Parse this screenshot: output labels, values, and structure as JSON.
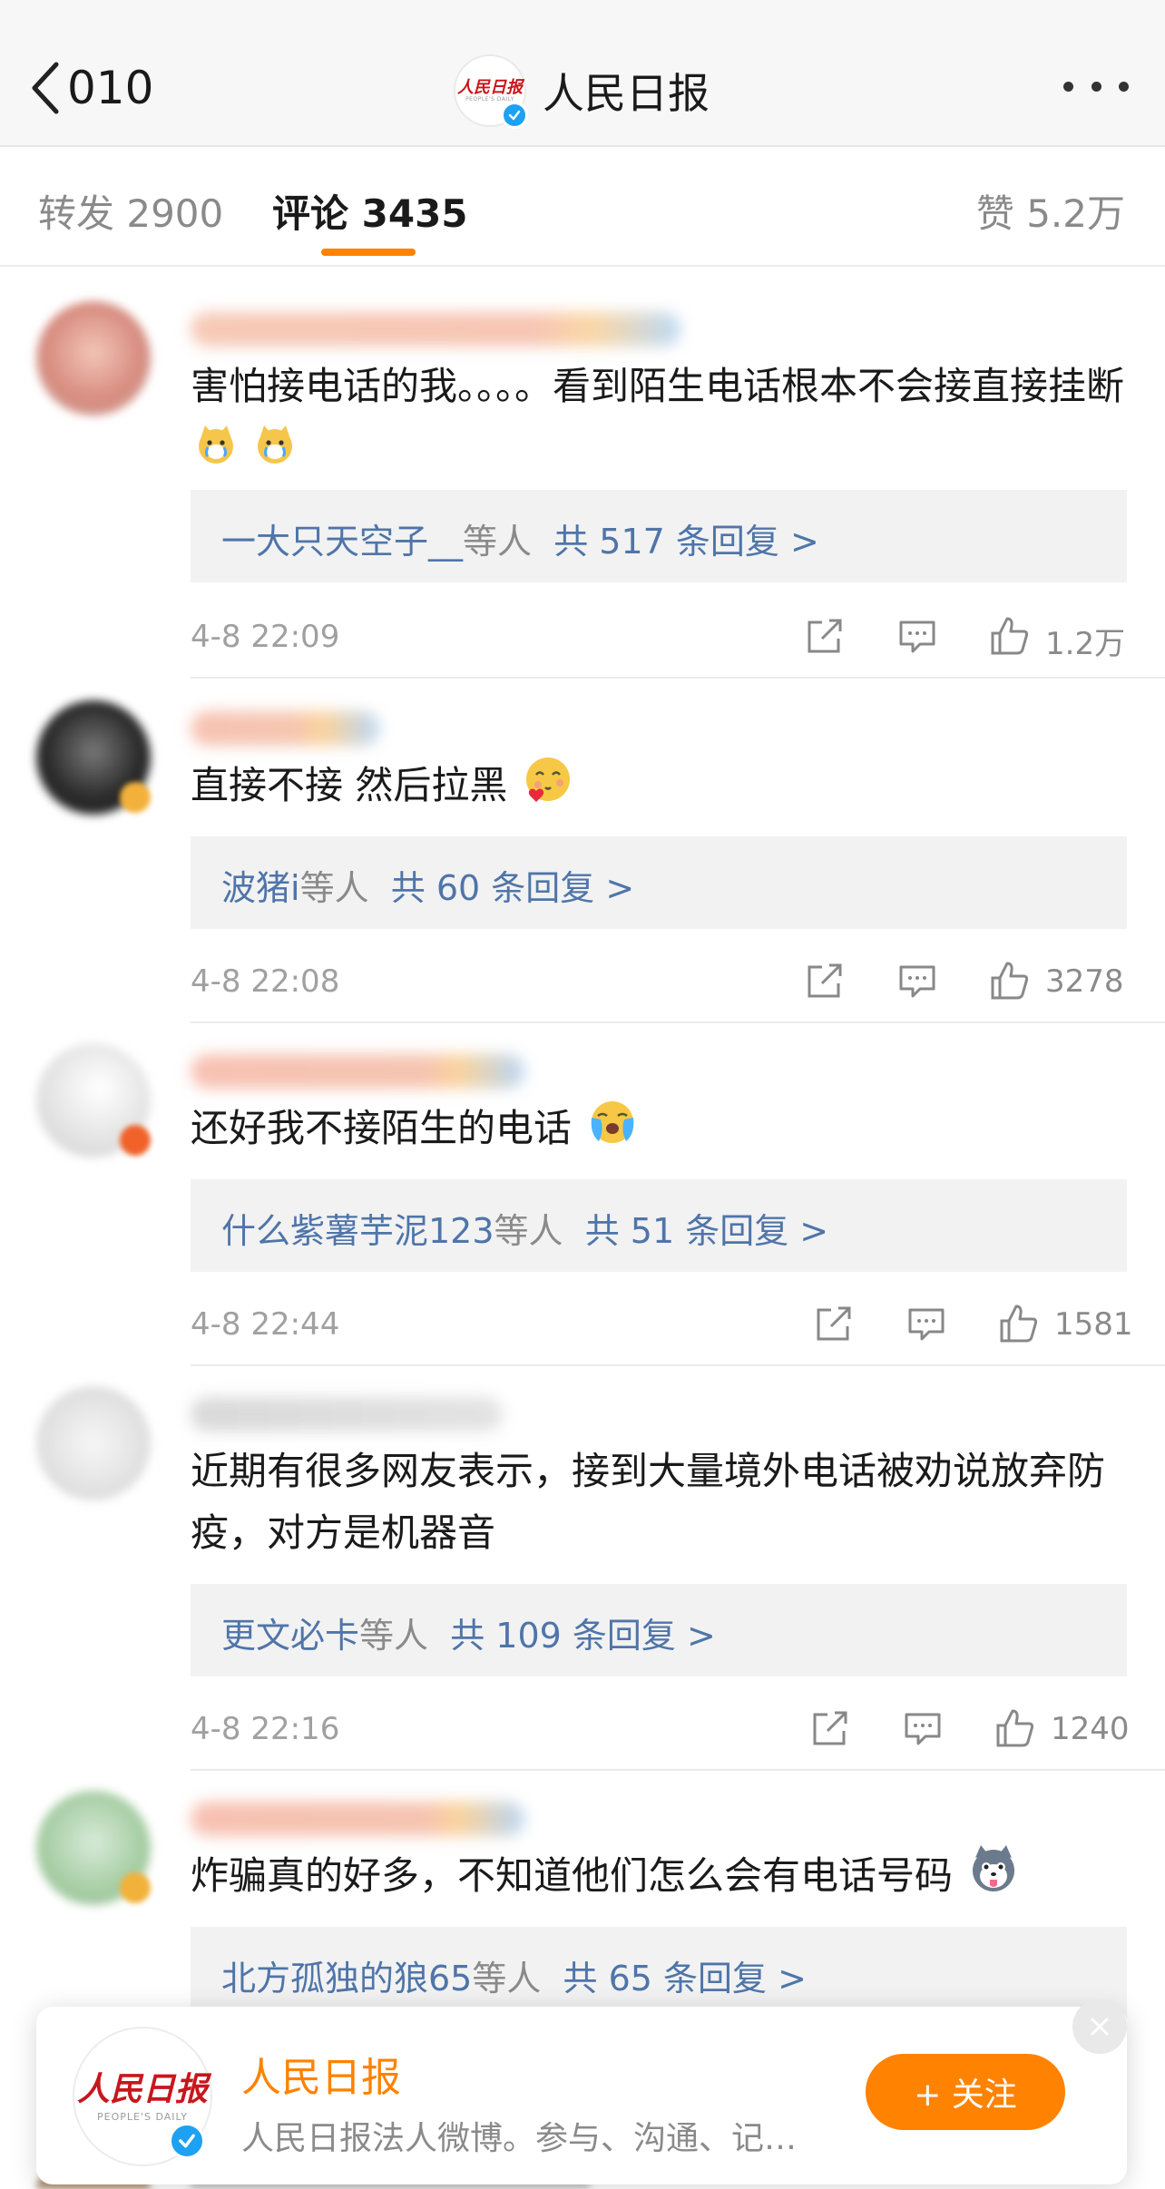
{
  "nav": {
    "back_count": "010",
    "title": "人民日报",
    "avatar_logo": "人民日报",
    "avatar_logo_en": "PEOPLE'S DAILY"
  },
  "tabs": {
    "repost": "转发 2900",
    "comments": "评论 3435",
    "likes": "赞 5.2万"
  },
  "comments": [
    {
      "text": "害怕接电话的我。。。。看到陌生电话根本不会接直接挂断",
      "emoji": [
        "crying-cat-emoji",
        "crying-cat-emoji"
      ],
      "reply_users": "一大只天空子__",
      "reply_sep": "等人",
      "reply_total": "共 517 条回复 >",
      "time": "4-8 22:09",
      "likes": "1.2万"
    },
    {
      "text": "直接不接 然后拉黑",
      "emoji": [
        "loving-face-emoji"
      ],
      "reply_users": "波猪i",
      "reply_sep": "等人",
      "reply_total": "共 60 条回复 >",
      "time": "4-8 22:08",
      "likes": "3278"
    },
    {
      "text": "还好我不接陌生的电话",
      "emoji": [
        "crying-face-emoji"
      ],
      "reply_users": "什么紫薯芋泥123",
      "reply_sep": "等人",
      "reply_total": "共 51 条回复 >",
      "time": "4-8 22:44",
      "likes": "1581"
    },
    {
      "text": "近期有很多网友表示，接到大量境外电话被劝说放弃防疫，对方是机器音",
      "emoji": [],
      "reply_users": "更文必卡",
      "reply_sep": "等人",
      "reply_total": "共 109 条回复 >",
      "time": "4-8 22:16",
      "likes": "1240"
    },
    {
      "text": "炸骗真的好多，不知道他们怎么会有电话号码",
      "emoji": [
        "husky-emoji"
      ],
      "reply_users": "北方孤独的狼65",
      "reply_sep": "等人",
      "reply_total": "共 65 条回复 >",
      "time": "",
      "likes": ""
    }
  ],
  "follow_card": {
    "name": "人民日报",
    "description": "人民日报法人微博。参与、沟通、记…",
    "button": "+ 关注",
    "logo": "人民日报",
    "logo_en": "PEOPLE'S DAILY"
  },
  "colors": {
    "accent": "#ff8200",
    "reply_link": "#4f75a9",
    "verified": "#1da1f2"
  }
}
